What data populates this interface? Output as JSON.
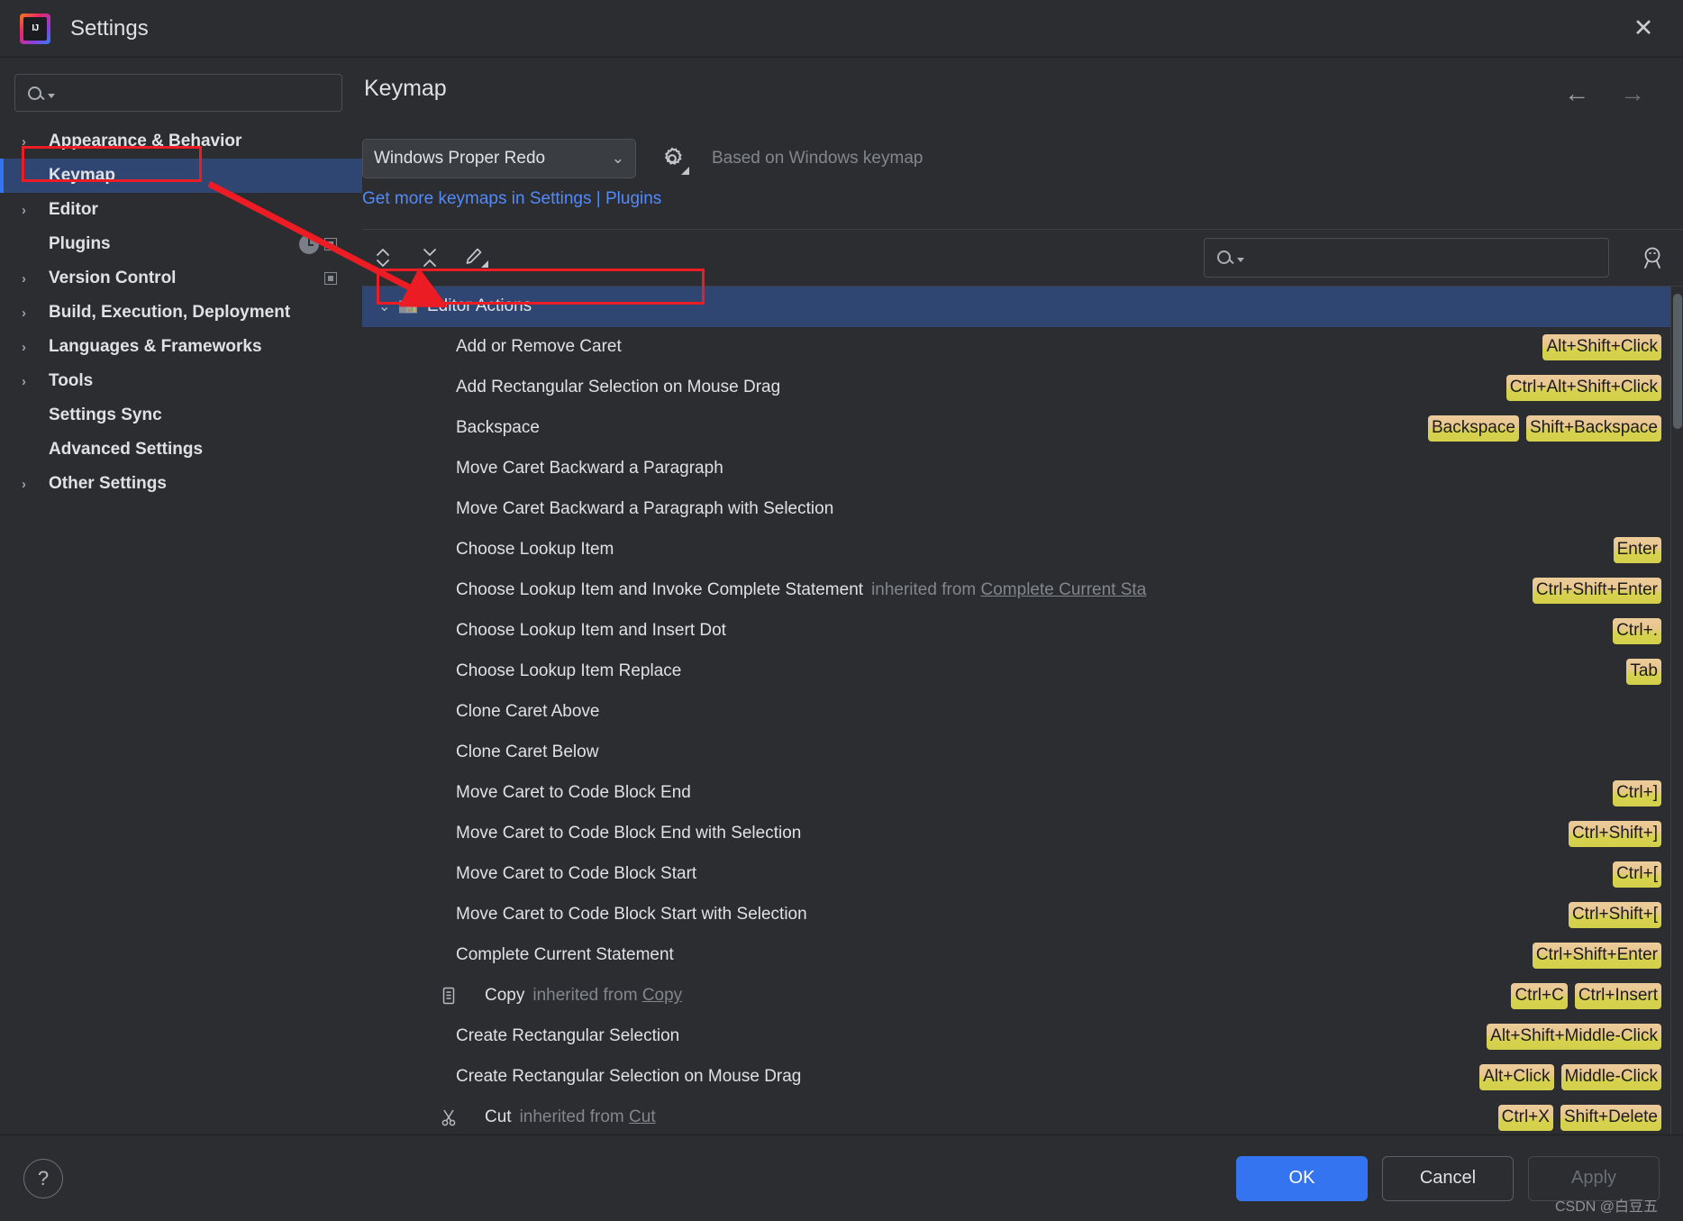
{
  "window": {
    "title": "Settings",
    "app_icon": "intellij-idea-logo",
    "close_label": "✕"
  },
  "sidebar": {
    "search": {
      "placeholder": "",
      "value": "",
      "icon": "search-icon"
    },
    "items": [
      {
        "label": "Appearance & Behavior",
        "expandable": true,
        "selected": false
      },
      {
        "label": "Keymap",
        "expandable": false,
        "selected": true
      },
      {
        "label": "Editor",
        "expandable": true,
        "selected": false
      },
      {
        "label": "Plugins",
        "expandable": false,
        "selected": false
      },
      {
        "label": "Version Control",
        "expandable": true,
        "selected": false
      },
      {
        "label": "Build, Execution, Deployment",
        "expandable": true,
        "selected": false
      },
      {
        "label": "Languages & Frameworks",
        "expandable": true,
        "selected": false
      },
      {
        "label": "Tools",
        "expandable": true,
        "selected": false
      },
      {
        "label": "Settings Sync",
        "expandable": false,
        "selected": false
      },
      {
        "label": "Advanced Settings",
        "expandable": false,
        "selected": false
      },
      {
        "label": "Other Settings",
        "expandable": true,
        "selected": false
      }
    ]
  },
  "main": {
    "page_title": "Keymap",
    "nav_back": "←",
    "nav_forward": "→",
    "keymap_select": {
      "value": "Windows Proper Redo",
      "chevron": "⌄"
    },
    "gear_icon": "gear-icon",
    "based_on": "Based on Windows keymap",
    "get_more_link": "Get more keymaps in Settings | Plugins",
    "toolbar": {
      "expand_all": "expand-all-icon",
      "collapse_all": "collapse-all-icon",
      "edit_shortcut": "edit-pencil-icon",
      "find_action_by_shortcut": "find-by-shortcut-icon"
    },
    "tree_search": {
      "placeholder": "",
      "value": "",
      "icon": "search-icon"
    }
  },
  "action_tree": {
    "group": {
      "label": "Editor Actions",
      "expanded": true,
      "chevron": "⌄",
      "icon": "editor-actions-folder-icon"
    },
    "rows": [
      {
        "name": "Add or Remove Caret",
        "inherited_from": null,
        "icon": null,
        "shortcuts": [
          "Alt+Shift+Click"
        ]
      },
      {
        "name": "Add Rectangular Selection on Mouse Drag",
        "inherited_from": null,
        "icon": null,
        "shortcuts": [
          "Ctrl+Alt+Shift+Click"
        ]
      },
      {
        "name": "Backspace",
        "inherited_from": null,
        "icon": null,
        "shortcuts": [
          "Backspace",
          "Shift+Backspace"
        ]
      },
      {
        "name": "Move Caret Backward a Paragraph",
        "inherited_from": null,
        "icon": null,
        "shortcuts": []
      },
      {
        "name": "Move Caret Backward a Paragraph with Selection",
        "inherited_from": null,
        "icon": null,
        "shortcuts": []
      },
      {
        "name": "Choose Lookup Item",
        "inherited_from": null,
        "icon": null,
        "shortcuts": [
          "Enter"
        ]
      },
      {
        "name": "Choose Lookup Item and Invoke Complete Statement",
        "inherited_from": "Complete Current Sta",
        "icon": null,
        "shortcuts": [
          "Ctrl+Shift+Enter"
        ]
      },
      {
        "name": "Choose Lookup Item and Insert Dot",
        "inherited_from": null,
        "icon": null,
        "shortcuts": [
          "Ctrl+."
        ]
      },
      {
        "name": "Choose Lookup Item Replace",
        "inherited_from": null,
        "icon": null,
        "shortcuts": [
          "Tab"
        ]
      },
      {
        "name": "Clone Caret Above",
        "inherited_from": null,
        "icon": null,
        "shortcuts": []
      },
      {
        "name": "Clone Caret Below",
        "inherited_from": null,
        "icon": null,
        "shortcuts": []
      },
      {
        "name": "Move Caret to Code Block End",
        "inherited_from": null,
        "icon": null,
        "shortcuts": [
          "Ctrl+]"
        ]
      },
      {
        "name": "Move Caret to Code Block End with Selection",
        "inherited_from": null,
        "icon": null,
        "shortcuts": [
          "Ctrl+Shift+]"
        ]
      },
      {
        "name": "Move Caret to Code Block Start",
        "inherited_from": null,
        "icon": null,
        "shortcuts": [
          "Ctrl+["
        ]
      },
      {
        "name": "Move Caret to Code Block Start with Selection",
        "inherited_from": null,
        "icon": null,
        "shortcuts": [
          "Ctrl+Shift+["
        ]
      },
      {
        "name": "Complete Current Statement",
        "inherited_from": null,
        "icon": null,
        "shortcuts": [
          "Ctrl+Shift+Enter"
        ]
      },
      {
        "name": "Copy",
        "inherited_from": "Copy",
        "icon": "copy-icon",
        "shortcuts": [
          "Ctrl+C",
          "Ctrl+Insert"
        ]
      },
      {
        "name": "Create Rectangular Selection",
        "inherited_from": null,
        "icon": null,
        "shortcuts": [
          "Alt+Shift+Middle-Click"
        ]
      },
      {
        "name": "Create Rectangular Selection on Mouse Drag",
        "inherited_from": null,
        "icon": null,
        "shortcuts": [
          "Alt+Click",
          "Middle-Click"
        ]
      },
      {
        "name": "Cut",
        "inherited_from": "Cut",
        "icon": "cut-icon",
        "shortcuts": [
          "Ctrl+X",
          "Shift+Delete"
        ]
      }
    ],
    "inherited_prefix": "inherited from"
  },
  "footer": {
    "help_label": "?",
    "ok_label": "OK",
    "cancel_label": "Cancel",
    "apply_label": "Apply",
    "watermark": "CSDN @白豆五"
  },
  "colors": {
    "accent_blue": "#3574f0",
    "selection_blue": "#2f4673",
    "link_blue": "#548af7",
    "shortcut_badge_top": "#eccc9a",
    "shortcut_badge_bottom": "#d4d04c",
    "annotation_red": "#ec1c24",
    "background": "#2b2d30",
    "text": "#dfe1e5",
    "muted_text": "#82868d"
  }
}
